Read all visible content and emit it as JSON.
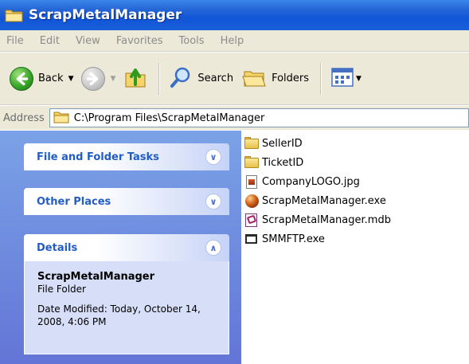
{
  "window": {
    "title": "ScrapMetalManager",
    "title_icon": "folder-icon"
  },
  "menu": {
    "items": [
      "File",
      "Edit",
      "View",
      "Favorites",
      "Tools",
      "Help"
    ]
  },
  "toolbar": {
    "back_label": "Back",
    "search_label": "Search",
    "folders_label": "Folders",
    "icons": [
      "back-arrow-icon",
      "forward-arrow-icon",
      "up-folder-icon",
      "search-icon",
      "folders-icon",
      "views-icon"
    ]
  },
  "address": {
    "label": "Address",
    "value": "C:\\Program Files\\ScrapMetalManager"
  },
  "taskpane": {
    "file_folder_tasks": {
      "title": "File and Folder Tasks",
      "state": "collapsed"
    },
    "other_places": {
      "title": "Other Places",
      "state": "collapsed"
    },
    "details": {
      "title": "Details",
      "state": "expanded",
      "name": "ScrapMetalManager",
      "type": "File Folder",
      "date_modified": "Date Modified: Today, October 14, 2008, 4:06 PM"
    }
  },
  "files": [
    {
      "name": "SellerID",
      "icon": "folder-icon"
    },
    {
      "name": "TicketID",
      "icon": "folder-icon"
    },
    {
      "name": "CompanyLOGO.jpg",
      "icon": "jpg-file-icon"
    },
    {
      "name": "ScrapMetalManager.exe",
      "icon": "exe-icon"
    },
    {
      "name": "ScrapMetalManager.mdb",
      "icon": "access-database-icon"
    },
    {
      "name": "SMMFTP.exe",
      "icon": "application-icon"
    }
  ],
  "colors": {
    "titlebar": "#0f55d8",
    "chrome": "#ece9d8",
    "taskpane_top": "#7ba2e7",
    "taskpane_bottom": "#6375d6",
    "panel_title": "#215dc6",
    "panel_body": "#d6dff7"
  }
}
